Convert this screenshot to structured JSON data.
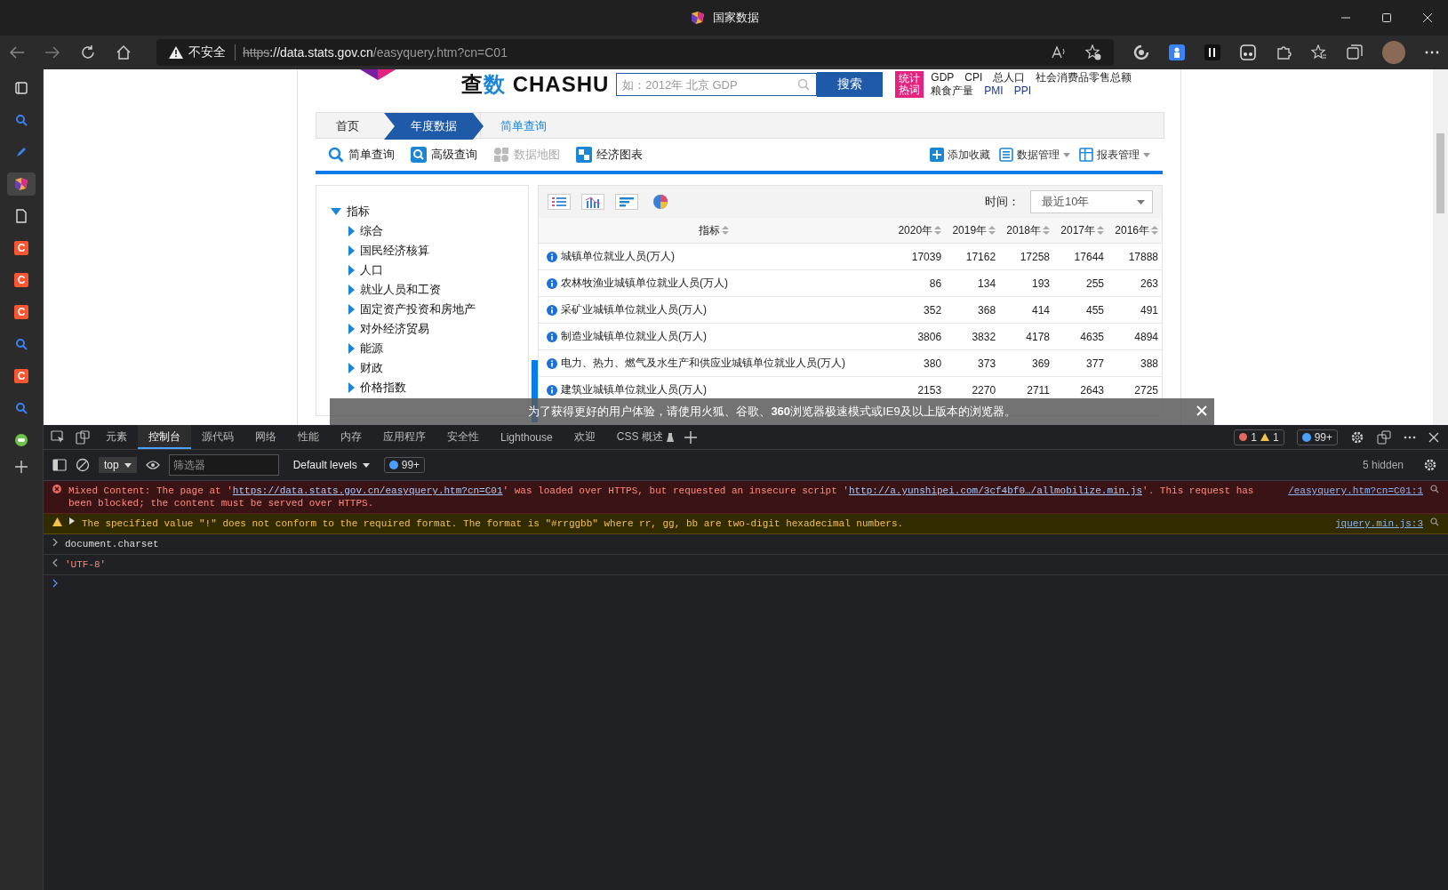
{
  "window": {
    "title": "国家数据"
  },
  "sidebar_tabs": [
    {
      "kind": "tabs",
      "selected": false
    },
    {
      "kind": "search",
      "selected": false
    },
    {
      "kind": "pen",
      "selected": false
    },
    {
      "kind": "logo",
      "selected": true
    },
    {
      "kind": "page",
      "selected": false
    },
    {
      "kind": "letter",
      "text": "C",
      "selected": false
    },
    {
      "kind": "letter",
      "text": "C",
      "selected": false
    },
    {
      "kind": "letter",
      "text": "C",
      "selected": false
    },
    {
      "kind": "search",
      "selected": false
    },
    {
      "kind": "letter",
      "text": "C",
      "selected": false
    },
    {
      "kind": "search",
      "selected": false
    },
    {
      "kind": "chat",
      "selected": false
    }
  ],
  "address_bar": {
    "security": "不安全",
    "url_scheme": "https",
    "url_host": "://data.stats.gov.cn",
    "url_path": "/easyquery.htm?cn=C01"
  },
  "site": {
    "logo": {
      "cn": [
        "查",
        "数"
      ],
      "en": "CHASHU"
    },
    "search": {
      "placeholder": "如：2012年 北京 GDP",
      "button": "搜索"
    },
    "hot_label": [
      "统计",
      "热词"
    ],
    "hot_words": [
      [
        "GDP",
        "CPI",
        "总人口",
        "社会消费品零售总额"
      ],
      [
        "粮食产量",
        "PMI",
        "PPI"
      ]
    ]
  },
  "breadcrumb": [
    {
      "label": "首页",
      "kind": "home"
    },
    {
      "label": "年度数据",
      "kind": "section"
    },
    {
      "label": "简单查询",
      "kind": "page"
    }
  ],
  "tools": [
    {
      "label": "简单查询",
      "kind": "search",
      "disabled": false
    },
    {
      "label": "高级查询",
      "kind": "search-box",
      "disabled": false
    },
    {
      "label": "数据地图",
      "kind": "map",
      "disabled": true
    },
    {
      "label": "经济图表",
      "kind": "chart",
      "disabled": false
    }
  ],
  "actions": [
    {
      "label": "添加收藏",
      "kind": "plus",
      "dropdown": false
    },
    {
      "label": "数据管理",
      "kind": "list",
      "dropdown": true
    },
    {
      "label": "报表管理",
      "kind": "table",
      "dropdown": true
    }
  ],
  "tree": {
    "label": "指标",
    "expanded": true,
    "children": [
      {
        "label": "综合",
        "expanded": false
      },
      {
        "label": "国民经济核算",
        "expanded": false
      },
      {
        "label": "人口",
        "expanded": false
      },
      {
        "label": "就业人员和工资",
        "expanded": false
      },
      {
        "label": "固定资产投资和房地产",
        "expanded": false
      },
      {
        "label": "对外经济贸易",
        "expanded": false
      },
      {
        "label": "能源",
        "expanded": false
      },
      {
        "label": "财政",
        "expanded": false
      },
      {
        "label": "价格指数",
        "expanded": false
      }
    ]
  },
  "view_buttons": [
    {
      "kind": "list"
    },
    {
      "kind": "bar"
    },
    {
      "kind": "hbar"
    },
    {
      "kind": "pie"
    }
  ],
  "time_filter": {
    "label": "时间：",
    "value": "最近10年"
  },
  "table": {
    "columns": [
      "指标",
      "2020年",
      "2019年",
      "2018年",
      "2017年",
      "2016年"
    ],
    "rows": [
      {
        "name": "城镇单位就业人员(万人)",
        "values": [
          "17039",
          "17162",
          "17258",
          "17644",
          "17888"
        ]
      },
      {
        "name": "农林牧渔业城镇单位就业人员(万人)",
        "values": [
          "86",
          "134",
          "193",
          "255",
          "263"
        ]
      },
      {
        "name": "采矿业城镇单位就业人员(万人)",
        "values": [
          "352",
          "368",
          "414",
          "455",
          "491"
        ]
      },
      {
        "name": "制造业城镇单位就业人员(万人)",
        "values": [
          "3806",
          "3832",
          "4178",
          "4635",
          "4894"
        ]
      },
      {
        "name": "电力、热力、燃气及水生产和供应业城镇单位就业人员(万人)",
        "values": [
          "380",
          "373",
          "369",
          "377",
          "388"
        ]
      },
      {
        "name": "建筑业城镇单位就业人员(万人)",
        "values": [
          "2153",
          "2270",
          "2711",
          "2643",
          "2725"
        ]
      }
    ]
  },
  "notice": {
    "text": "为了获得更好的用户体验，请使用火狐、谷歌、**360**浏览器极速模式或IE9及以上版本的浏览器。"
  },
  "devtools": {
    "tabs": [
      {
        "label": "元素",
        "selected": false
      },
      {
        "label": "控制台",
        "selected": true
      },
      {
        "label": "源代码",
        "selected": false
      },
      {
        "label": "网络",
        "selected": false
      },
      {
        "label": "性能",
        "selected": false
      },
      {
        "label": "内存",
        "selected": false
      },
      {
        "label": "应用程序",
        "selected": false
      },
      {
        "label": "安全性",
        "selected": false
      },
      {
        "label": "Lighthouse",
        "selected": false
      },
      {
        "label": "欢迎",
        "selected": false
      },
      {
        "label": "CSS 概述",
        "selected": false
      }
    ],
    "errors": "1",
    "warnings": "1",
    "issues": "99+",
    "context": "top",
    "filter_placeholder": "筛选器",
    "levels": "Default levels",
    "level_issues": "99+",
    "hidden": "5 hidden"
  },
  "console": [
    {
      "kind": "error",
      "parts": [
        {
          "text": "Mixed Content: The page at '",
          "link": false
        },
        {
          "text": "https://data.stats.gov.cn/easyquery.htm?cn=C01",
          "link": true
        },
        {
          "text": "' was loaded over HTTPS, but requested an insecure script '",
          "link": false
        },
        {
          "text": "http://a.yunshipei.com/3cf4bf0…/allmobilize.min.js",
          "link": true
        },
        {
          "text": "'. This request has been blocked; the content must be served over HTTPS.",
          "link": false
        }
      ],
      "source": "/easyquery.htm?cn=C01:1"
    },
    {
      "kind": "warning",
      "parts": [
        {
          "text": "The specified value \"!\" does not conform to the required format.  The format is \"#rrggbb\" where rr, gg, bb are two-digit hexadecimal numbers.",
          "link": false
        }
      ],
      "source": "jquery.min.js:3"
    },
    {
      "kind": "input",
      "text": "document.charset"
    },
    {
      "kind": "output",
      "text": "'UTF-8'"
    },
    {
      "kind": "prompt"
    }
  ]
}
